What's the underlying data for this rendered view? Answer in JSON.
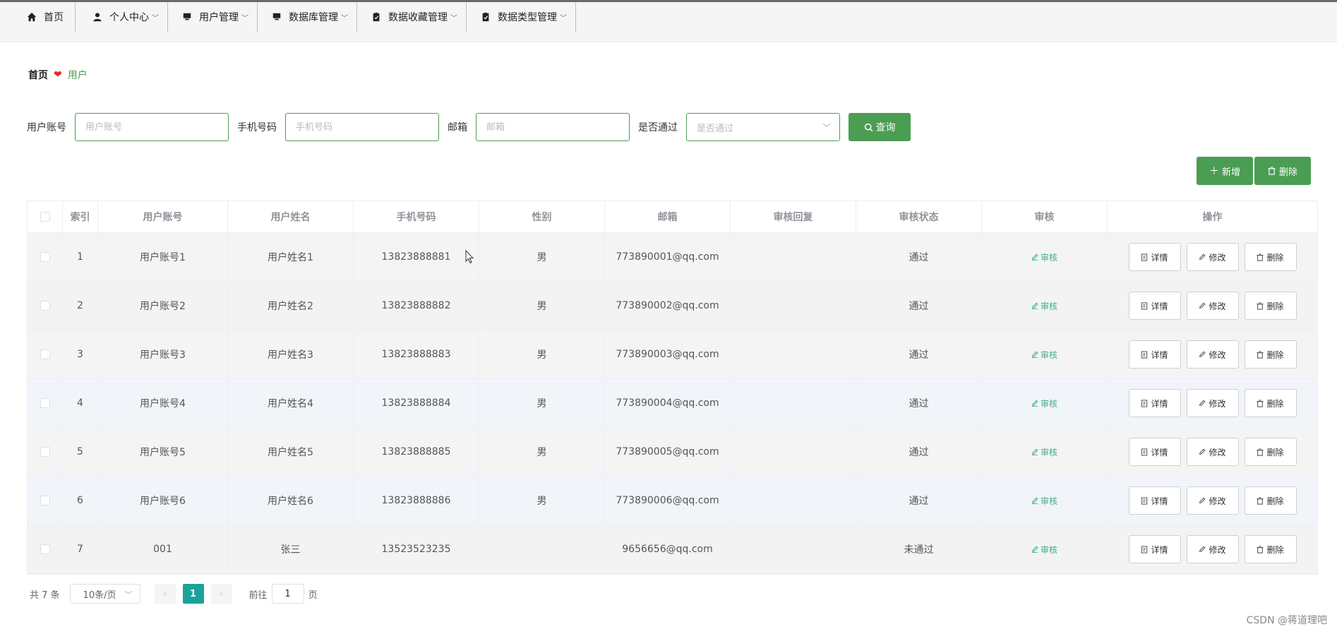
{
  "nav": [
    {
      "label": "首页",
      "icon": "home-icon",
      "has_menu": false
    },
    {
      "label": "个人中心",
      "icon": "user-icon",
      "has_menu": true
    },
    {
      "label": "用户管理",
      "icon": "monitor-icon",
      "has_menu": true
    },
    {
      "label": "数据库管理",
      "icon": "monitor-icon",
      "has_menu": true
    },
    {
      "label": "数据收藏管理",
      "icon": "clipboard-icon",
      "has_menu": true
    },
    {
      "label": "数据类型管理",
      "icon": "clipboard-icon",
      "has_menu": true
    }
  ],
  "breadcrumb": {
    "home": "首页",
    "current": "用户"
  },
  "search": {
    "account_label": "用户账号",
    "account_placeholder": "用户账号",
    "phone_label": "手机号码",
    "phone_placeholder": "手机号码",
    "email_label": "邮箱",
    "email_placeholder": "邮箱",
    "pass_label": "是否通过",
    "pass_placeholder": "是否通过",
    "query_label": "查询"
  },
  "actions": {
    "add_label": "新增",
    "delete_label": "删除"
  },
  "table": {
    "headers": [
      "索引",
      "用户账号",
      "用户姓名",
      "手机号码",
      "性别",
      "邮箱",
      "审核回复",
      "审核状态",
      "审核",
      "操作"
    ],
    "audit_label": "审核",
    "op_labels": {
      "detail": "详情",
      "edit": "修改",
      "delete": "删除"
    },
    "rows": [
      {
        "idx": "1",
        "account": "用户账号1",
        "name": "用户姓名1",
        "phone": "13823888881",
        "sex": "男",
        "email": "773890001@qq.com",
        "reply": "",
        "status": "通过"
      },
      {
        "idx": "2",
        "account": "用户账号2",
        "name": "用户姓名2",
        "phone": "13823888882",
        "sex": "男",
        "email": "773890002@qq.com",
        "reply": "",
        "status": "通过"
      },
      {
        "idx": "3",
        "account": "用户账号3",
        "name": "用户姓名3",
        "phone": "13823888883",
        "sex": "男",
        "email": "773890003@qq.com",
        "reply": "",
        "status": "通过"
      },
      {
        "idx": "4",
        "account": "用户账号4",
        "name": "用户姓名4",
        "phone": "13823888884",
        "sex": "男",
        "email": "773890004@qq.com",
        "reply": "",
        "status": "通过"
      },
      {
        "idx": "5",
        "account": "用户账号5",
        "name": "用户姓名5",
        "phone": "13823888885",
        "sex": "男",
        "email": "773890005@qq.com",
        "reply": "",
        "status": "通过"
      },
      {
        "idx": "6",
        "account": "用户账号6",
        "name": "用户姓名6",
        "phone": "13823888886",
        "sex": "男",
        "email": "773890006@qq.com",
        "reply": "",
        "status": "通过"
      },
      {
        "idx": "7",
        "account": "001",
        "name": "张三",
        "phone": "13523523235",
        "sex": "",
        "email": "9656656@qq.com",
        "reply": "",
        "status": "未通过"
      }
    ]
  },
  "pager": {
    "total": "共 7 条",
    "size": "10条/页",
    "current": "1",
    "goto_prefix": "前往",
    "goto_value": "1",
    "goto_suffix": "页"
  },
  "watermark": "CSDN @蒋道理吧",
  "colors": {
    "accent": "#4a9d52",
    "teal": "#1aa39a",
    "audit": "#3fae8c"
  }
}
